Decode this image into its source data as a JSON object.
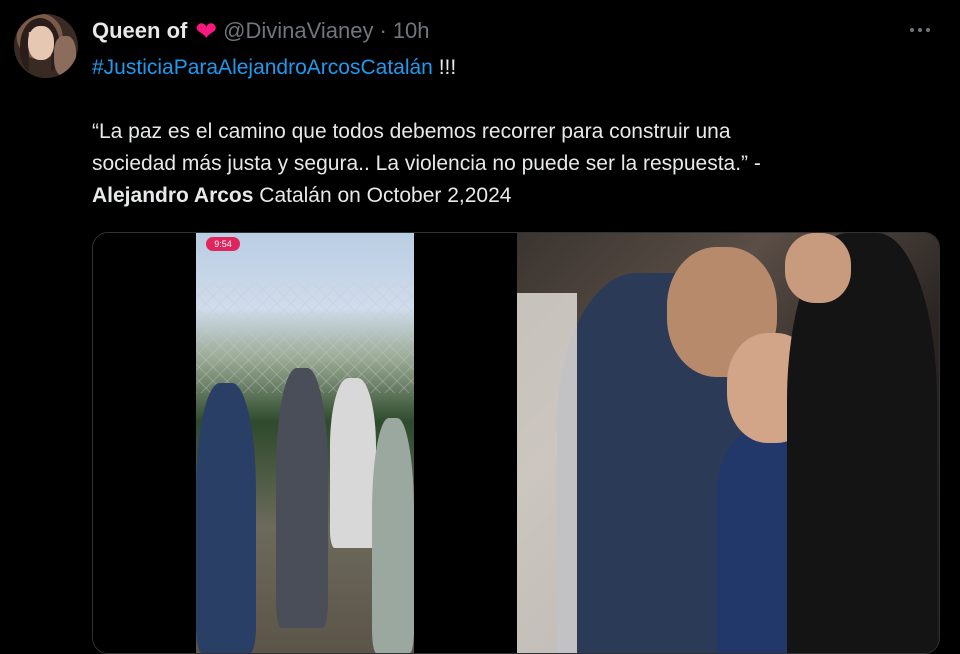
{
  "author": {
    "display_name": "Queen of",
    "heart": "❤",
    "handle": "@DivinaVianey",
    "separator": "·",
    "time": "10h"
  },
  "tweet": {
    "hashtag": "#JusticiaParaAlejandroArcosCatalán",
    "exclaim": " !!!",
    "quote_line1": "“La paz es el camino que todos debemos recorrer para construir una",
    "quote_line2": "sociedad más justa y segura.. La violencia no puede ser la respuesta.” -",
    "author_bold": "Alejandro Arcos",
    "author_rest": " Catalán on October 2,2024"
  },
  "media": {
    "left_phone_status": "9:54",
    "items": [
      "video-screenshot",
      "photo-hug"
    ]
  },
  "icons": {
    "more": "more-horizontal-icon"
  },
  "colors": {
    "background": "#000000",
    "text": "#e7e9ea",
    "secondary": "#71767b",
    "link": "#1d9bf0",
    "heart": "#f91880"
  }
}
